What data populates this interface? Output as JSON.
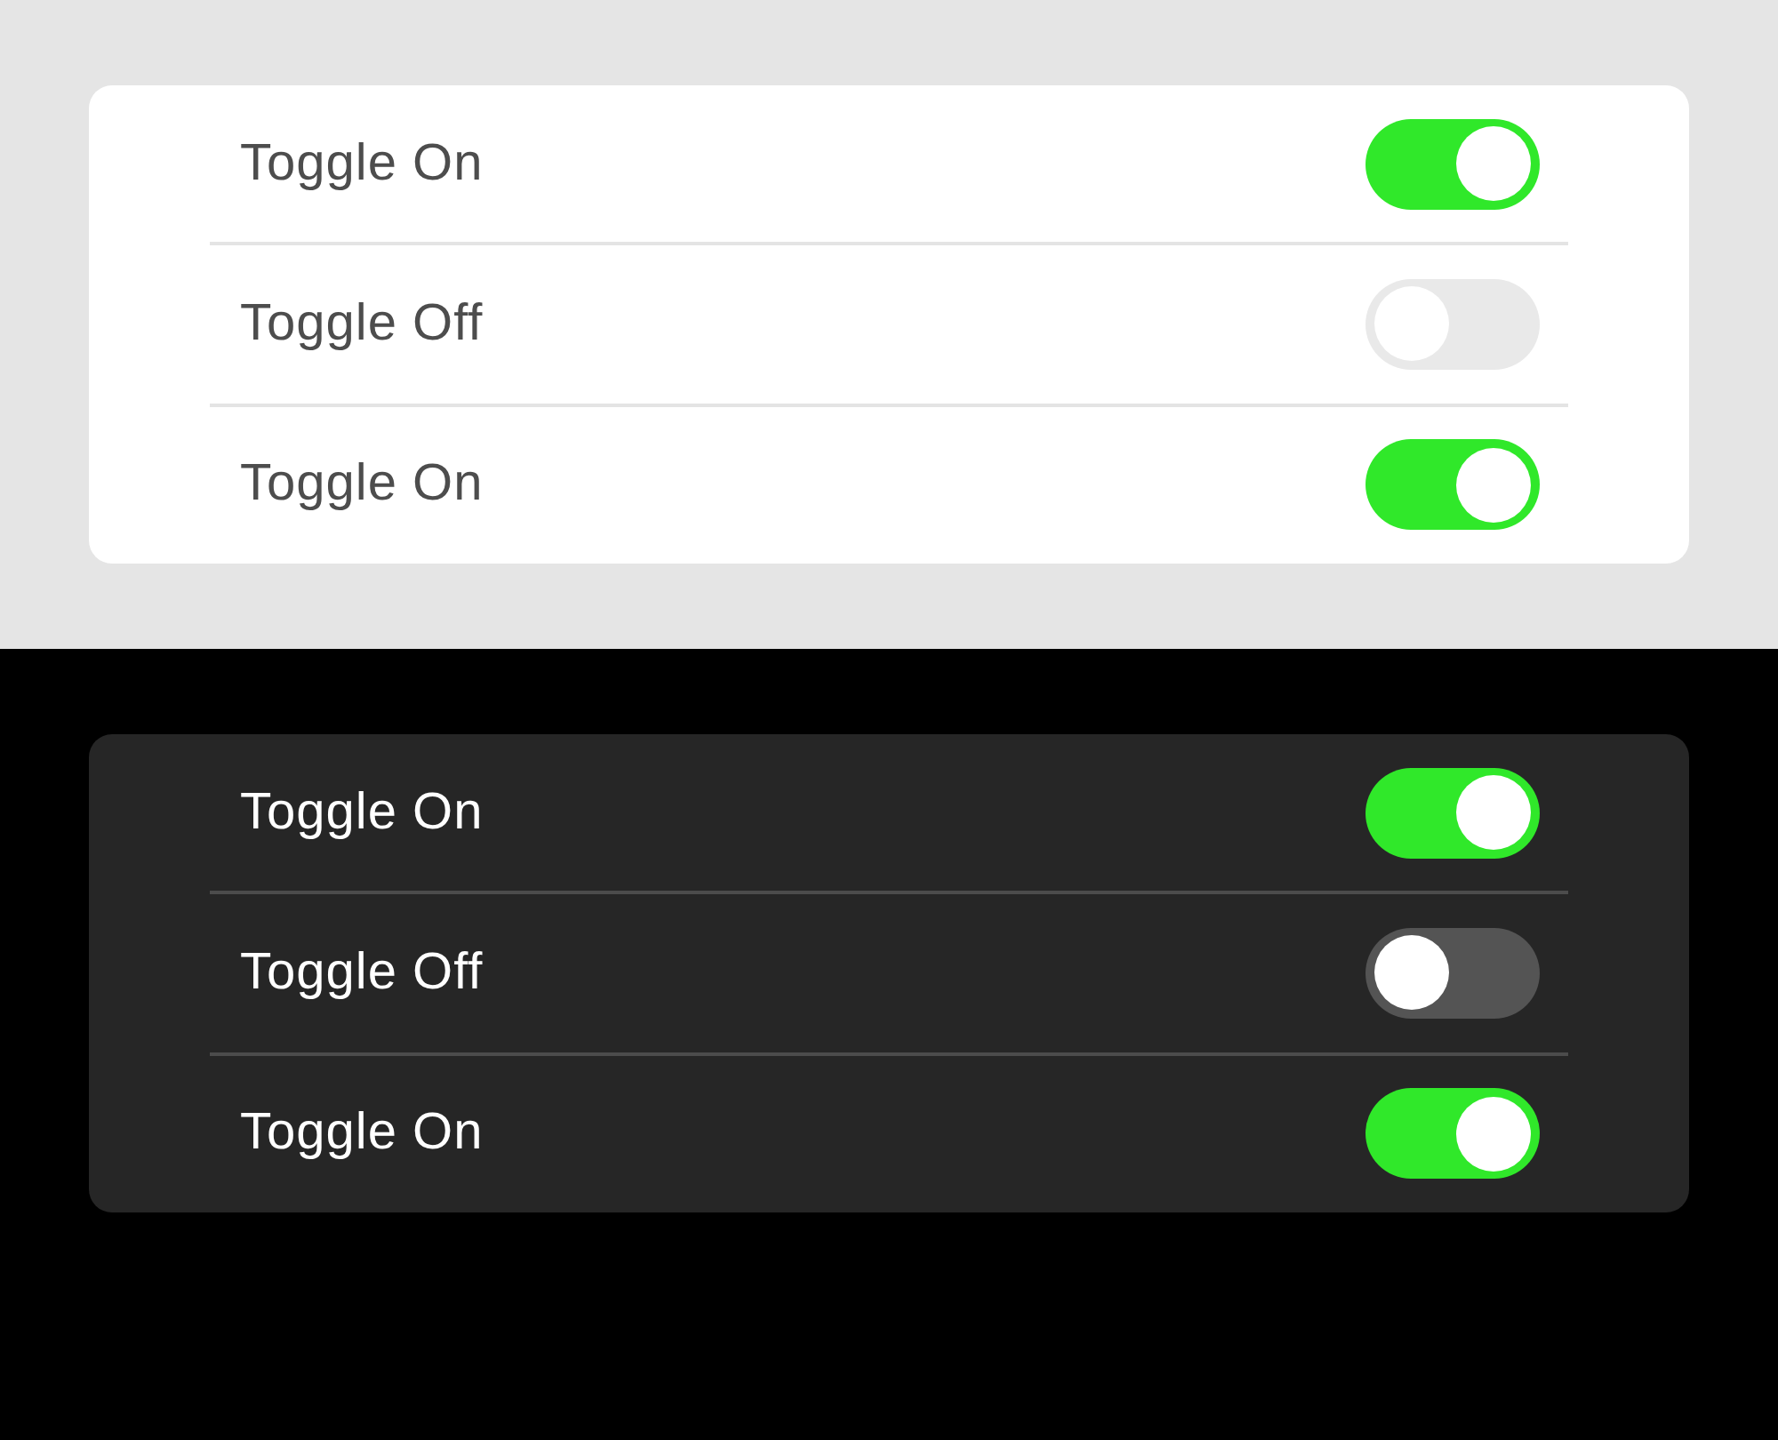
{
  "panels": [
    {
      "kind": "light",
      "rows": [
        {
          "label": "Toggle On",
          "on": true
        },
        {
          "label": "Toggle Off",
          "on": false
        },
        {
          "label": "Toggle On",
          "on": true
        }
      ]
    },
    {
      "kind": "dark",
      "rows": [
        {
          "label": "Toggle On",
          "on": true
        },
        {
          "label": "Toggle Off",
          "on": false
        },
        {
          "label": "Toggle On",
          "on": true
        }
      ]
    }
  ]
}
